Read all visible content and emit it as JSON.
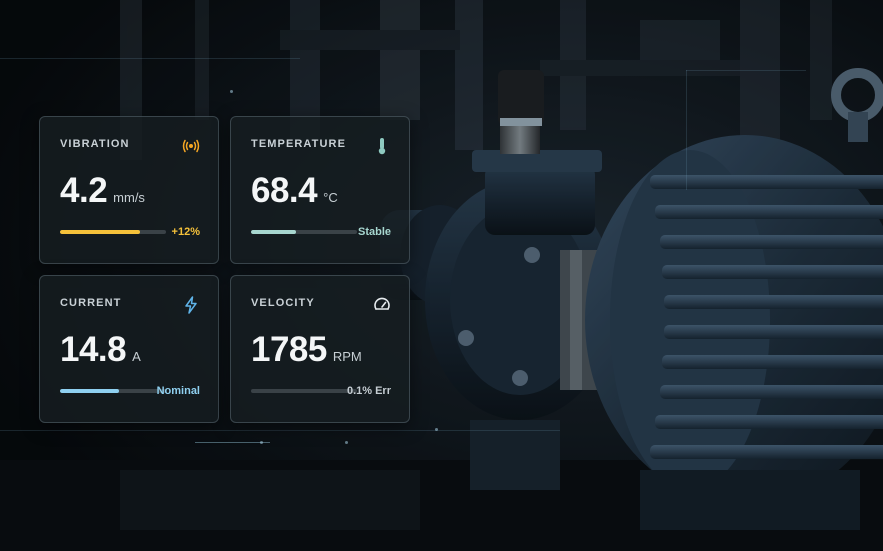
{
  "metrics": [
    {
      "id": "vibration",
      "label": "VIBRATION",
      "value": "4.2",
      "unit": "mm/s",
      "status": "+12%",
      "progress": 0.75,
      "accent": "#f5c13a",
      "status_color": "#f5c13a",
      "icon": "vibration-signal-icon"
    },
    {
      "id": "temperature",
      "label": "TEMPERATURE",
      "value": "68.4",
      "unit": "°C",
      "status": "Stable",
      "progress": 0.42,
      "accent": "#a7d6cf",
      "status_color": "#a7d6cf",
      "icon": "thermometer-icon"
    },
    {
      "id": "current",
      "label": "CURRENT",
      "value": "14.8",
      "unit": "A",
      "status": "Nominal",
      "progress": 0.56,
      "accent": "#8fd0f0",
      "status_color": "#8fd0f0",
      "icon": "lightning-bolt-icon"
    },
    {
      "id": "velocity",
      "label": "VELOCITY",
      "value": "1785",
      "unit": "RPM",
      "status": "0.1% Err",
      "progress": 0.0,
      "accent": "#5a6166",
      "status_color": "#c5cdd2",
      "icon": "speedometer-gauge-icon"
    }
  ]
}
